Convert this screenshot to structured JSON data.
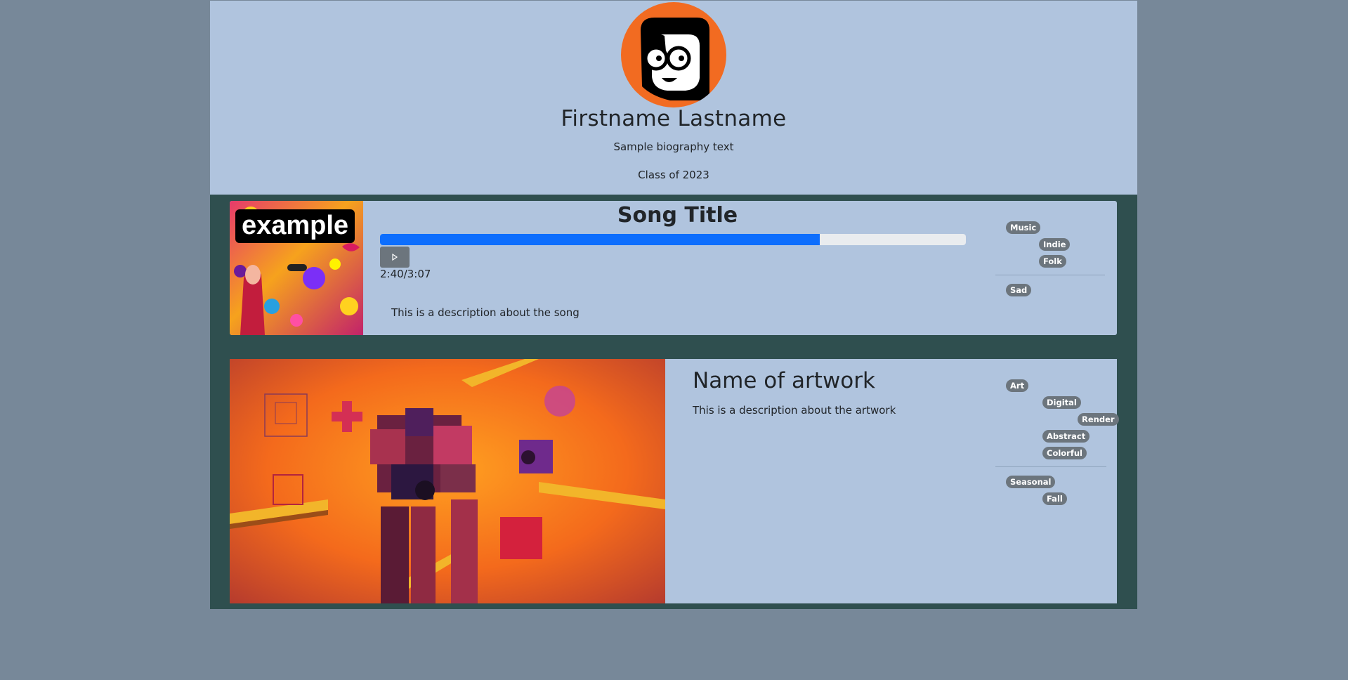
{
  "profile": {
    "name": "Firstname Lastname",
    "bio": "Sample biography text",
    "class_year": "Class of 2023"
  },
  "song": {
    "cover_text": "example",
    "title": "Song Title",
    "progress": 0.75,
    "time": "2:40/3:07",
    "description": "This is a description about the song",
    "tags": [
      "Music",
      "Indie",
      "Folk",
      "Sad"
    ]
  },
  "artwork": {
    "title": "Name of artwork",
    "description": "This is a description about the artwork",
    "tags": [
      "Art",
      "Digital",
      "Render",
      "Abstract",
      "Colorful",
      "Seasonal",
      "Fall"
    ]
  },
  "colors": {
    "page_background": "#778899",
    "card_background": "#b0c4de",
    "section_background": "#2f4f4f",
    "avatar_background": "#f26b21",
    "progress_fill": "#0d6efd",
    "tag_background": "#6c757d"
  },
  "icons": {
    "play": "play-icon"
  }
}
